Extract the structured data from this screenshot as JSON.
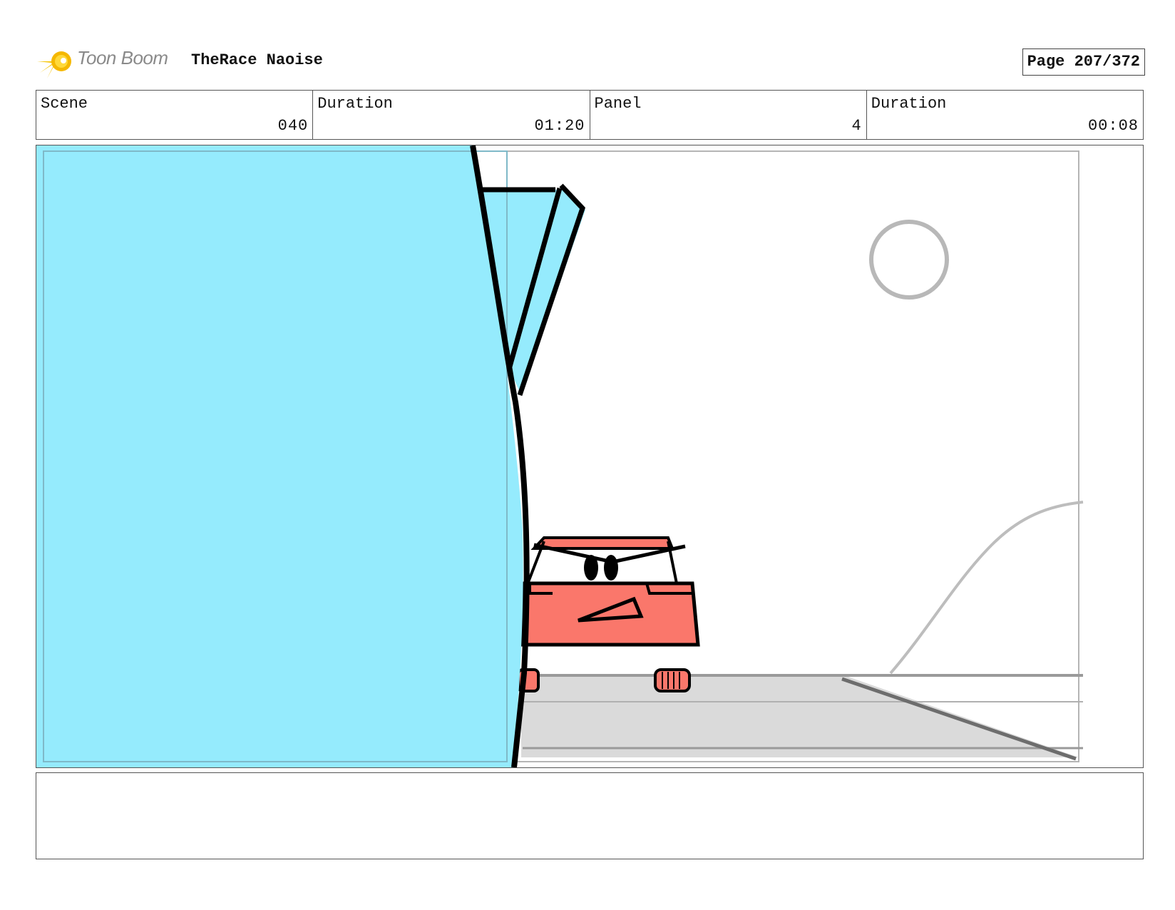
{
  "header": {
    "brand": "Toon Boom",
    "project_title": "TheRace Naoise",
    "page_label": "Page 207/372"
  },
  "info": {
    "scene_label": "Scene",
    "scene_value": "040",
    "scene_duration_label": "Duration",
    "scene_duration_value": "01:20",
    "panel_label": "Panel",
    "panel_value": "4",
    "panel_duration_label": "Duration",
    "panel_duration_value": "00:08"
  },
  "colors": {
    "wall_blue": "#95EBFD",
    "car_red": "#FA776B",
    "road_grey": "#DADADA",
    "logo_yellow": "#F5C400"
  },
  "notes": ""
}
